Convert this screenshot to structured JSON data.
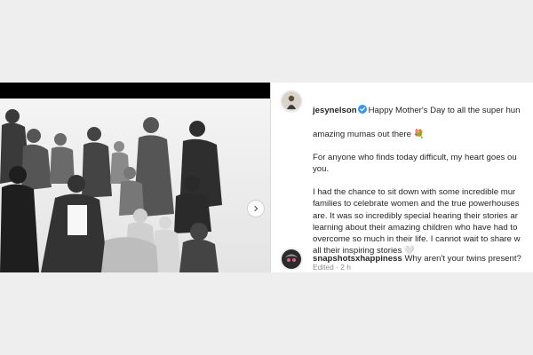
{
  "post": {
    "carousel_next_icon": "chevron-right-icon",
    "caption": {
      "username": "jesynelson",
      "verified": true,
      "line1": "Happy Mother's Day to all the super hun",
      "line2": "amazing mumas out there 💐",
      "para2": "For anyone who finds today difficult, my heart goes ou\nyou.",
      "para3": "I had the chance to sit down with some incredible mur\nfamilies to celebrate women and the true powerhouses\nare. It was so incredibly special hearing their stories ar\nlearning about their amazing children who have had to\novercome so much in their life. I cannot wait to share w\nall their inspiring stories",
      "heart": "🤍",
      "edited": "Edited",
      "separator": "·",
      "time": "2 h"
    },
    "reply": {
      "username": "snapshotsxhappiness",
      "text": "Why aren't your twins present?"
    }
  },
  "colors": {
    "accent_verified": "#3897f0",
    "text": "#262626",
    "muted": "#8e8e8e"
  }
}
